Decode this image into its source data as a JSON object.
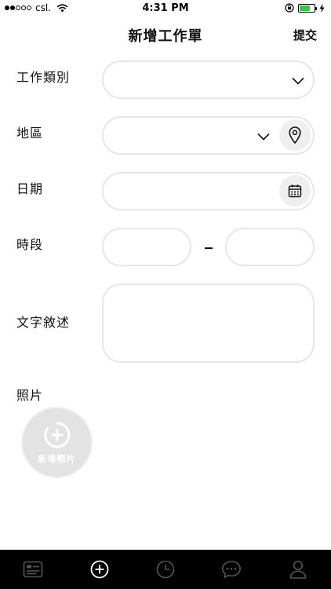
{
  "status_bar": {
    "carrier": "csl.",
    "time": "4:31 PM"
  },
  "nav": {
    "title": "新增工作單",
    "submit_label": "提交"
  },
  "form": {
    "job_type_label": "工作類別",
    "region_label": "地區",
    "date_label": "日期",
    "time_slot_label": "時段",
    "description_label": "文字敘述",
    "photos_label": "照片",
    "add_photo_label": "新增照片"
  },
  "icons": {
    "job_type_dropdown": "chevron-down-icon",
    "region_dropdown": "chevron-down-icon",
    "region_locate": "location-pin-icon",
    "date_picker": "calendar-icon",
    "add_photo": "camera-plus-icon"
  },
  "tab_bar": {
    "tabs": [
      "list-icon",
      "add-circle-icon",
      "clock-icon",
      "chat-icon",
      "user-icon"
    ],
    "active_index": 1
  },
  "colors": {
    "field_border": "#e7e7e7",
    "tab_bar_bg": "#000000",
    "battery": "#2ecc40"
  }
}
